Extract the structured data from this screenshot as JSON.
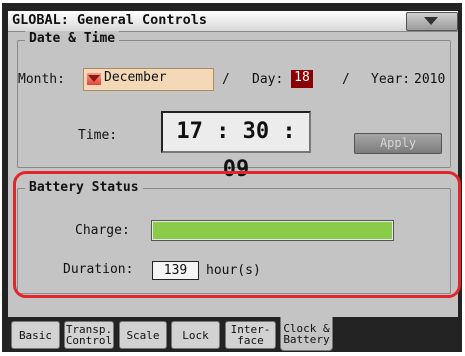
{
  "window": {
    "title": "GLOBAL: General Controls",
    "menu_icon": "chevron-down-icon"
  },
  "date_time": {
    "legend": "Date & Time",
    "month_label": "Month:",
    "month_value": "December",
    "separator1": "/",
    "day_label": "Day:",
    "day_value": "18",
    "separator2": "/",
    "year_label": "Year:",
    "year_value": "2010",
    "time_label": "Time:",
    "time_value": "17 : 30 : 09",
    "apply_label": "Apply"
  },
  "battery": {
    "legend": "Battery Status",
    "charge_label": "Charge:",
    "charge_level_fraction": 1.0,
    "charge_color": "#8acb4a",
    "duration_label": "Duration:",
    "duration_value": "139",
    "duration_unit": "hour(s)"
  },
  "highlight_color": "#e2252b",
  "tabs": [
    {
      "label": "Basic"
    },
    {
      "label": "Transp.\nControl"
    },
    {
      "label": "Scale"
    },
    {
      "label": "Lock"
    },
    {
      "label": "Inter-\nface"
    },
    {
      "label": "Clock &\nBattery",
      "active": true
    }
  ]
}
